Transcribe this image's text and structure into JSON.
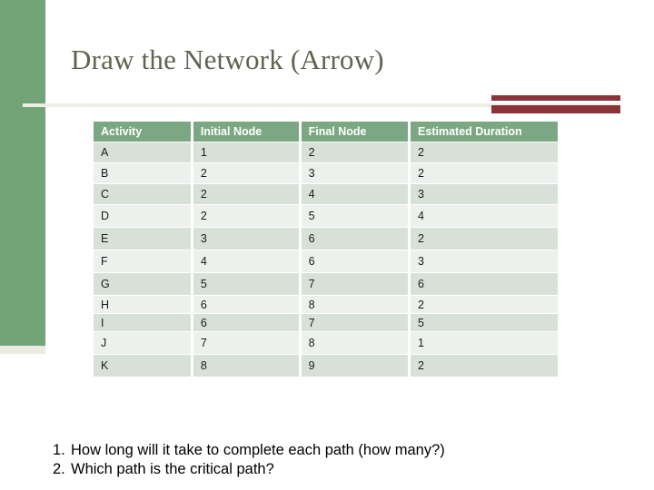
{
  "slide": {
    "title": "Draw the Network (Arrow)",
    "background_color": "#ffffff",
    "accent_green": "#72a478",
    "accent_red": "#8b3338",
    "title_color": "#5f6350",
    "divider_color": "#edede3"
  },
  "table": {
    "header_background": "#7ba883",
    "row_shade_dark": "#d8e1d8",
    "row_shade_light": "#edf1ed",
    "columns": [
      "Activity",
      "Initial Node",
      "Final Node",
      "Estimated Duration"
    ],
    "rows": [
      {
        "activity": "A",
        "initial_node": "1",
        "final_node": "2",
        "estimated_duration": "2"
      },
      {
        "activity": "B",
        "initial_node": "2",
        "final_node": "3",
        "estimated_duration": "2"
      },
      {
        "activity": "C",
        "initial_node": "2",
        "final_node": "4",
        "estimated_duration": "3"
      },
      {
        "activity": "D",
        "initial_node": "2",
        "final_node": "5",
        "estimated_duration": "4"
      },
      {
        "activity": "E",
        "initial_node": "3",
        "final_node": "6",
        "estimated_duration": "2"
      },
      {
        "activity": "F",
        "initial_node": "4",
        "final_node": "6",
        "estimated_duration": "3"
      },
      {
        "activity": "G",
        "initial_node": "5",
        "final_node": "7",
        "estimated_duration": "6"
      },
      {
        "activity": "H",
        "initial_node": "6",
        "final_node": "8",
        "estimated_duration": "2"
      },
      {
        "activity": "I",
        "initial_node": "6",
        "final_node": "7",
        "estimated_duration": "5"
      },
      {
        "activity": "J",
        "initial_node": "7",
        "final_node": "8",
        "estimated_duration": "1"
      },
      {
        "activity": "K",
        "initial_node": "8",
        "final_node": "9",
        "estimated_duration": "2"
      }
    ]
  },
  "questions": [
    {
      "number": "1.",
      "text": "How long will it take to complete each path (how many?)"
    },
    {
      "number": "2.",
      "text": "Which path is the critical path?"
    }
  ]
}
